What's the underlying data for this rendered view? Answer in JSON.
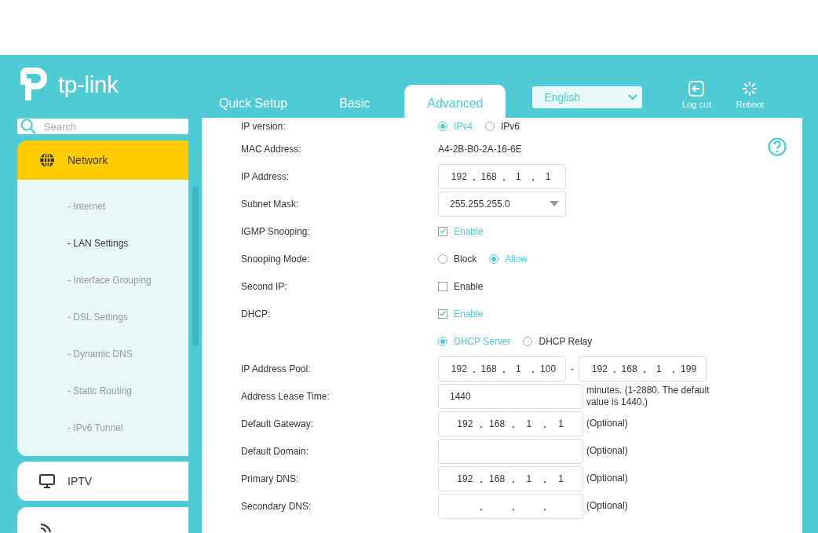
{
  "header": {
    "logo_text": "tp-link",
    "tabs": [
      {
        "label": "Quick Setup",
        "selected": false
      },
      {
        "label": "Basic",
        "selected": false
      },
      {
        "label": "Advanced",
        "selected": true
      }
    ],
    "language": {
      "value": "English"
    },
    "actions": [
      {
        "kind": "logout",
        "label": "Log out"
      },
      {
        "kind": "reboot",
        "label": "Reboot"
      }
    ]
  },
  "sidebar": {
    "search": {
      "placeholder": "Search"
    },
    "items": [
      {
        "kind": "network",
        "label": "Network",
        "selected": true,
        "children": [
          {
            "label": "- Internet",
            "selected": false
          },
          {
            "label": "- LAN Settings",
            "selected": true
          },
          {
            "label": "- Interface Grouping",
            "selected": false
          },
          {
            "label": "- DSL Settings",
            "selected": false
          },
          {
            "label": "- Dynamic DNS",
            "selected": false
          },
          {
            "label": "- Static Routing",
            "selected": false
          },
          {
            "label": "- IPv6 Tunnel",
            "selected": false
          }
        ]
      },
      {
        "kind": "iptv",
        "label": "IPTV",
        "selected": false
      },
      {
        "kind": "wireless",
        "selected": false
      }
    ]
  },
  "form": {
    "rows": [
      {
        "kind": "radio",
        "label": "IP version:",
        "options": [
          {
            "label": "IPv4",
            "selected": true
          },
          {
            "label": "IPv6",
            "selected": false
          }
        ]
      },
      {
        "kind": "text",
        "label": "MAC Address:",
        "value": "A4-2B-B0-2A-16-6E"
      },
      {
        "kind": "ip",
        "label": "IP Address:",
        "octets": [
          "192",
          "168",
          "1",
          "1"
        ]
      },
      {
        "kind": "select",
        "label": "Subnet Mask:",
        "value": "255.255.255.0"
      },
      {
        "kind": "checkbox",
        "label": "IGMP Snooping:",
        "option": "Enable",
        "checked": true
      },
      {
        "kind": "radio",
        "label": "Snooping Mode:",
        "options": [
          {
            "label": "Block",
            "selected": false
          },
          {
            "label": "Allow",
            "selected": true
          }
        ]
      },
      {
        "kind": "checkbox",
        "label": "Second IP:",
        "option": "Enable",
        "checked": false
      },
      {
        "kind": "checkbox",
        "label": "DHCP:",
        "option": "Enable",
        "checked": true
      },
      {
        "kind": "radio",
        "options": [
          {
            "label": "DHCP Server",
            "selected": true
          },
          {
            "label": "DHCP Relay",
            "selected": false
          }
        ]
      },
      {
        "kind": "ip_range",
        "label": "IP Address Pool:",
        "from": [
          "192",
          "168",
          "1",
          "100"
        ],
        "separator": "-",
        "to": [
          "192",
          "168",
          "1",
          "199"
        ]
      },
      {
        "kind": "input",
        "label": "Address Lease Time:",
        "value": "1440",
        "note": "minutes. (1-2880. The default value is 1440.)"
      },
      {
        "kind": "ip",
        "label": "Default Gateway:",
        "octets": [
          "192",
          "168",
          "1",
          "1"
        ],
        "note": "(Optional)"
      },
      {
        "kind": "input",
        "label": "Default Domain:",
        "note": "(Optional)"
      },
      {
        "kind": "ip",
        "label": "Primary DNS:",
        "octets": [
          "192",
          "168",
          "1",
          "1"
        ],
        "note": "(Optional)"
      },
      {
        "kind": "ip",
        "label": "Secondary DNS:",
        "note": "(Optional)"
      }
    ]
  }
}
